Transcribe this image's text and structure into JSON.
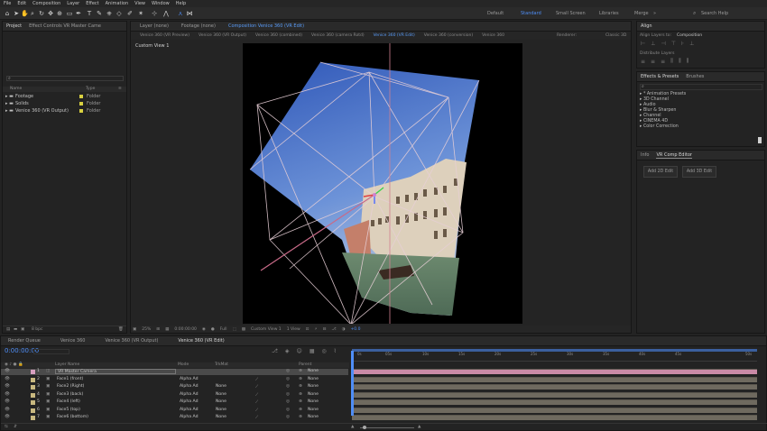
{
  "menu": [
    "File",
    "Edit",
    "Composition",
    "Layer",
    "Effect",
    "Animation",
    "View",
    "Window",
    "Help"
  ],
  "workspaces": {
    "items": [
      "Default",
      "Standard",
      "Small Screen",
      "Libraries",
      "Merge"
    ],
    "active": "Standard",
    "search_placeholder": "Search Help"
  },
  "project_panel": {
    "tabs": [
      "Project",
      "Effect Controls VR Master Came"
    ],
    "columns": {
      "name": "Name",
      "type": "Type"
    },
    "items": [
      {
        "name": "Footage",
        "type": "Folder"
      },
      {
        "name": "Solids",
        "type": "Folder"
      },
      {
        "name": "Venice 360 (VR Output)",
        "type": "Folder"
      }
    ],
    "bpc": "8 bpc"
  },
  "viewer": {
    "tabs": [
      "Layer (none)",
      "Footage (none)",
      "Composition Venice 360 (VR Edit)"
    ],
    "comp_tabs": [
      "Venice 360 (VR Preview)",
      "Venice 360 (VR Output)",
      "Venice 360 (combined)",
      "Venice 360 (camera Rotd)",
      "Venice 360 (VR Edit)",
      "Venice 360 (conversion)",
      "Venice 360"
    ],
    "renderer_label": "Renderer:",
    "renderer_value": "Classic 3D",
    "view_label": "Custom View 1",
    "footer": {
      "zoom": "25%",
      "timecode": "0:00:00:00",
      "resolution": "Full",
      "view": "Custom View 1",
      "views": "1 View",
      "offset": "+0.0"
    }
  },
  "align_panel": {
    "title": "Align",
    "align_to_label": "Align Layers to:",
    "align_to_value": "Composition",
    "distribute_label": "Distribute Layers"
  },
  "effects_panel": {
    "tabs": [
      "Effects & Presets",
      "Brushes"
    ],
    "items": [
      "* Animation Presets",
      "3D Channel",
      "Audio",
      "Blur & Sharpen",
      "Channel",
      "CINEMA 4D",
      "Color Correction"
    ]
  },
  "vr_panel": {
    "tabs": [
      "Info",
      "VR Comp Editor"
    ],
    "buttons": [
      "Add 2D Edit",
      "Add 3D Edit"
    ]
  },
  "timeline": {
    "tabs": [
      "Render Queue",
      "Venice 360",
      "Venice 360 (VR Output)",
      "Venice 360 (VR Edit)"
    ],
    "timecode": "0:00:00:00",
    "columns": {
      "layer_name": "Layer Name",
      "mode": "Mode",
      "trkmat": "TrkMat",
      "parent": "Parent"
    },
    "layers": [
      {
        "num": "1",
        "name": "VR Master Camera",
        "mode": "",
        "trkmat": "",
        "parent": "None"
      },
      {
        "num": "2",
        "name": "Face1 (front)",
        "mode": "Alpha Ad",
        "trkmat": "",
        "parent": "None"
      },
      {
        "num": "3",
        "name": "Face2 (Right)",
        "mode": "Alpha Ad",
        "trkmat": "None",
        "parent": "None"
      },
      {
        "num": "4",
        "name": "Face3 (back)",
        "mode": "Alpha Ad",
        "trkmat": "None",
        "parent": "None"
      },
      {
        "num": "5",
        "name": "Face4 (left)",
        "mode": "Alpha Ad",
        "trkmat": "None",
        "parent": "None"
      },
      {
        "num": "6",
        "name": "Face5 (top)",
        "mode": "Alpha Ad",
        "trkmat": "None",
        "parent": "None"
      },
      {
        "num": "7",
        "name": "Face6 (bottom)",
        "mode": "Alpha Ad",
        "trkmat": "None",
        "parent": "None"
      }
    ],
    "ruler": [
      "0s",
      "05s",
      "10s",
      "15s",
      "20s",
      "25s",
      "30s",
      "35s",
      "40s",
      "45s",
      "50s"
    ]
  }
}
